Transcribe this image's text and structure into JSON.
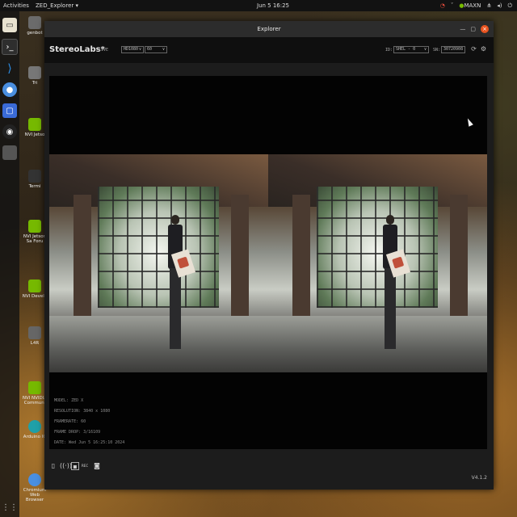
{
  "topbar": {
    "activities": "Activities",
    "app_menu": "ZED_Explorer ▾",
    "clock": "Jun 5 16:25",
    "tray": [
      "MAXN"
    ]
  },
  "desktop_icons": [
    "genbot",
    "Tri",
    "NVI Jetso",
    "Termi",
    "NVI Jetson Sa Foru",
    "NVI Develo",
    "L4R",
    "NVI NVIDIA Communi",
    "Arduino IC",
    "Chromium Web Browser"
  ],
  "window": {
    "title": "Explorer"
  },
  "header": {
    "logo": "StereoLabs*",
    "status": "LIVE",
    "resolution": "HD1080",
    "fps": "60",
    "id_label": "ID:",
    "id_value": "SHEL - 0",
    "sn_label": "SN:",
    "sn_value": "30720908"
  },
  "info": {
    "model": "MODEL: ZED X",
    "resolution": "RESOLUTION: 3840 x 1080",
    "framerate": "FRAMERATE: 60",
    "frame_drop": "FRAME DROP: 3/16109",
    "date": "DATE: Wed Jun 5 16:25:10 2024"
  },
  "footer": {
    "rec_label": "REC",
    "version": "V4.1.2"
  }
}
